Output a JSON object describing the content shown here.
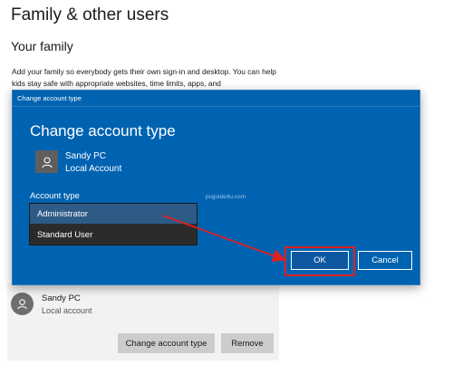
{
  "settings": {
    "title": "Family & other users",
    "section": "Your family",
    "description": "Add your family so everybody gets their own sign-in and desktop. You can help kids stay safe with appropriate websites, time limits, apps, and"
  },
  "user_panel": {
    "name": "Sandy PC",
    "type": "Local account",
    "change_label": "Change account type",
    "remove_label": "Remove"
  },
  "dialog": {
    "titlebar": "Change account type",
    "heading": "Change account type",
    "user_name": "Sandy PC",
    "user_type": "Local Account",
    "account_type_label": "Account type",
    "watermark": "pcguide4u.com",
    "options": [
      "Administrator",
      "Standard User"
    ],
    "ok_label": "OK",
    "cancel_label": "Cancel"
  },
  "colors": {
    "dialog_bg": "#0063b1",
    "highlight": "#e02020"
  }
}
